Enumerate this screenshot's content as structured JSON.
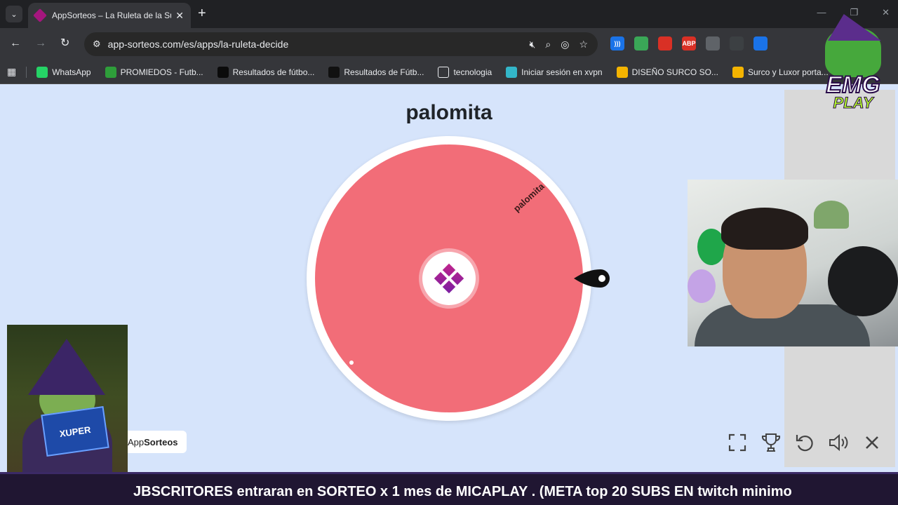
{
  "browser": {
    "tab_title": "AppSorteos – La Ruleta de la Suerte",
    "url": "app-sorteos.com/es/apps/la-ruleta-decide",
    "new_tab": "+",
    "tab_close": "✕"
  },
  "bookmarks": [
    {
      "label": "WhatsApp",
      "icon": "whatsapp-icon",
      "color": "#25d366"
    },
    {
      "label": "PROMIEDOS - Futb...",
      "icon": "promiedos-icon",
      "color": "#2e9e3a"
    },
    {
      "label": "Resultados de fútbo...",
      "icon": "score-icon",
      "color": "#0b0b0b"
    },
    {
      "label": "Resultados de Fútb...",
      "icon": "results-icon",
      "color": "#111111"
    },
    {
      "label": "tecnologia",
      "icon": "folder-icon",
      "color": "#35363a"
    },
    {
      "label": "Iniciar sesión en xvpn",
      "icon": "xvpn-icon",
      "color": "#33b6c9"
    },
    {
      "label": "DISEÑO SURCO SO...",
      "icon": "slides-icon",
      "color": "#f4b400"
    },
    {
      "label": "Surco y Luxor porta...",
      "icon": "slides-icon",
      "color": "#f4b400"
    }
  ],
  "extensions": [
    {
      "name": "audio-ext-icon",
      "color": "#1a73e8",
      "text": ")))"
    },
    {
      "name": "map-ext-icon",
      "color": "#3aa757",
      "text": ""
    },
    {
      "name": "hand-ext-icon",
      "color": "#d93025",
      "text": ""
    },
    {
      "name": "adblock-ext-icon",
      "color": "#d93025",
      "text": "ABP"
    },
    {
      "name": "feather-ext-icon",
      "color": "#5f6368",
      "text": ""
    },
    {
      "name": "cast-ext-icon",
      "color": "#3c4043",
      "text": ""
    },
    {
      "name": "translate-ext-icon",
      "color": "#1a73e8",
      "text": ""
    },
    {
      "name": "puzzle-ext-icon",
      "color": "#35363a",
      "text": ""
    }
  ],
  "page": {
    "result_title": "palomita",
    "segment_label": "palomita",
    "wheel_color": "#f26d78",
    "badge_prefix": "App",
    "badge_bold": "Sorteos"
  },
  "overlay": {
    "ticker": "JBSCRITORES entraran en SORTEO x 1 mes de MICAPLAY .  (META  top 20 SUBS  EN  twitch minimo",
    "emg_line1": "EMG",
    "emg_line2": "PLAY",
    "box_brand": "XUPER"
  }
}
